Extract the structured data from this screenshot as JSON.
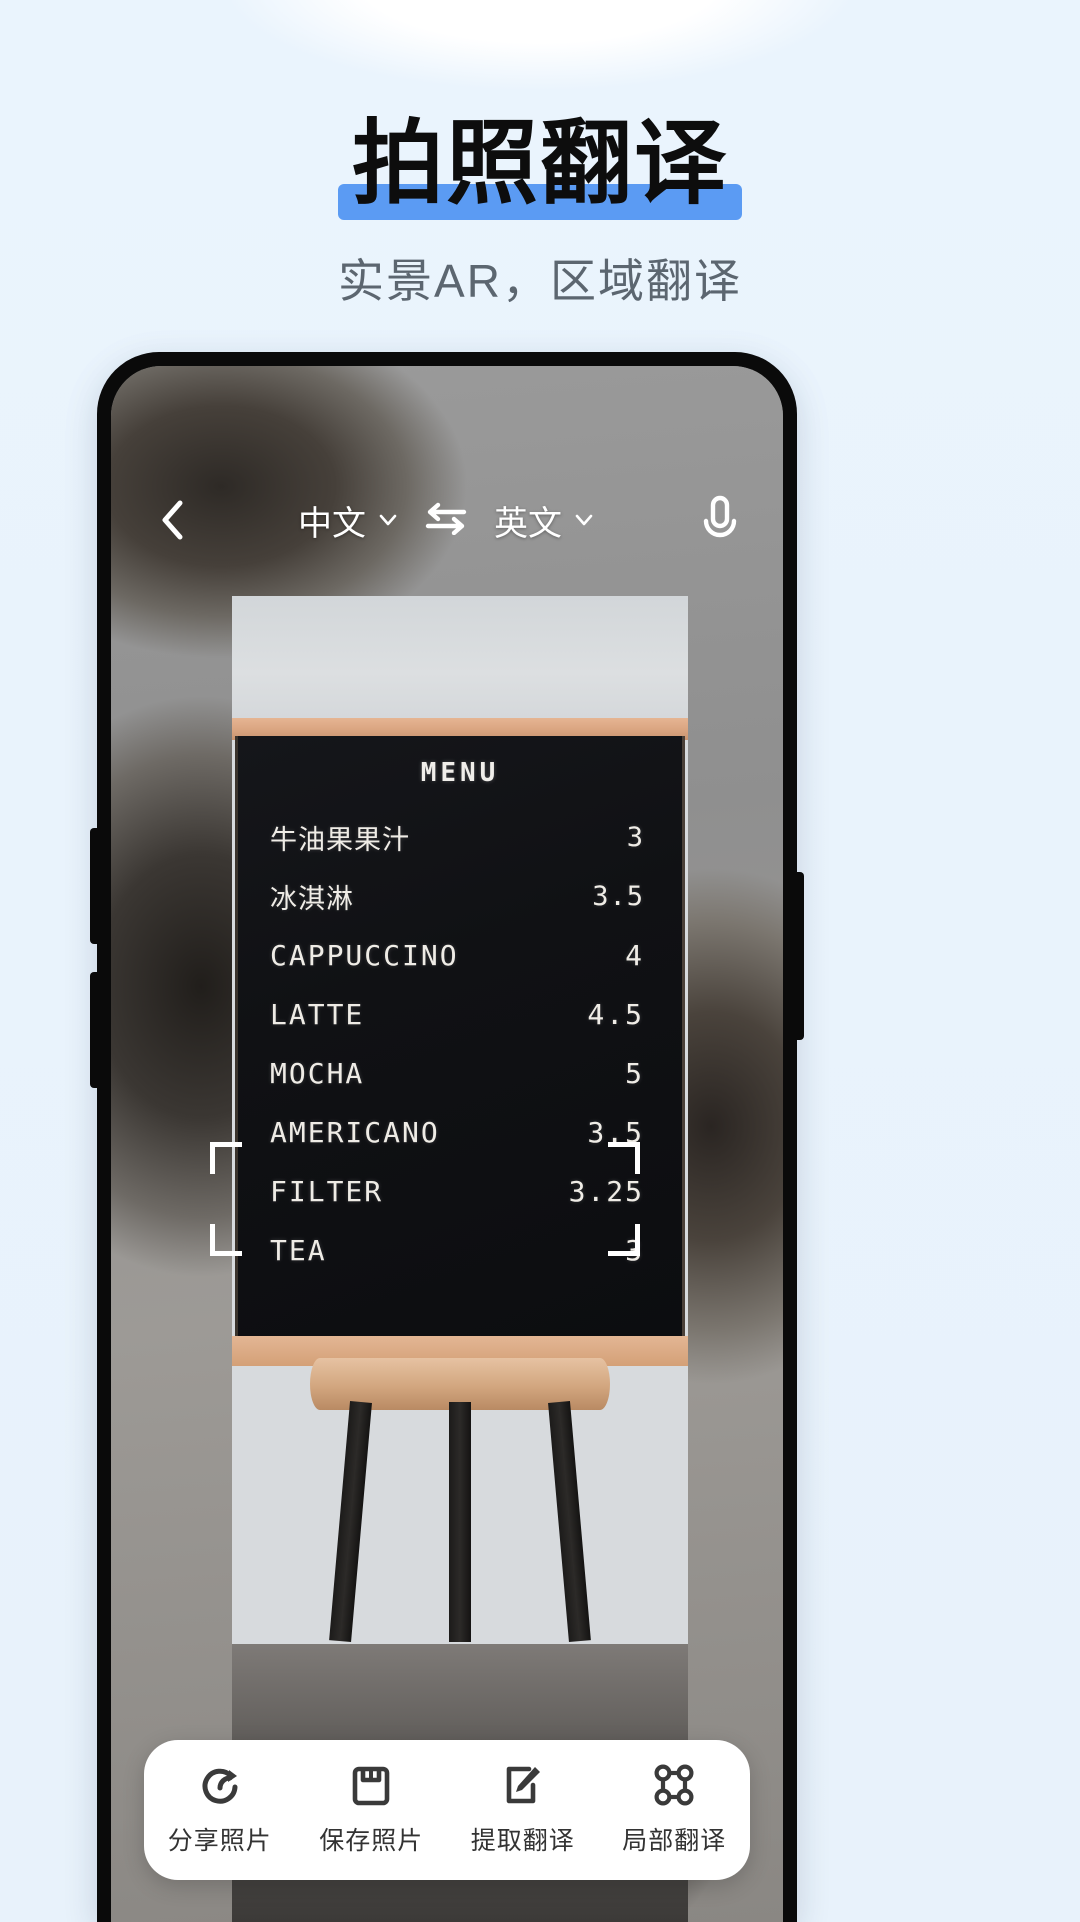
{
  "promo": {
    "title": "拍照翻译",
    "subtitle": "实景AR，区域翻译",
    "highlight_color": "#5b9bf3",
    "background_color": "#e8f3fc"
  },
  "nav": {
    "back_icon": "chevron-left-icon",
    "source_lang": "中文",
    "target_lang": "英文",
    "swap_icon": "swap-arrows-icon",
    "dropdown_icon": "chevron-down-icon",
    "mic_icon": "microphone-icon"
  },
  "photo": {
    "board_title": "MENU",
    "menu_items": [
      {
        "name": "牛油果果汁",
        "price": "3",
        "translated": true
      },
      {
        "name": "冰淇淋",
        "price": "3.5",
        "translated": true
      },
      {
        "name": "CAPPUCCINO",
        "price": "4",
        "translated": false
      },
      {
        "name": "LATTE",
        "price": "4.5",
        "translated": false
      },
      {
        "name": "MOCHA",
        "price": "5",
        "translated": false
      },
      {
        "name": "AMERICANO",
        "price": "3.5",
        "translated": false
      },
      {
        "name": "FILTER",
        "price": "3.25",
        "translated": false
      },
      {
        "name": "TEA",
        "price": "3",
        "translated": false
      }
    ]
  },
  "toolbar": {
    "items": [
      {
        "label": "分享照片",
        "icon": "share-photo-icon"
      },
      {
        "label": "保存照片",
        "icon": "save-photo-icon"
      },
      {
        "label": "提取翻译",
        "icon": "extract-translation-icon"
      },
      {
        "label": "局部翻译",
        "icon": "region-translate-icon"
      }
    ]
  }
}
